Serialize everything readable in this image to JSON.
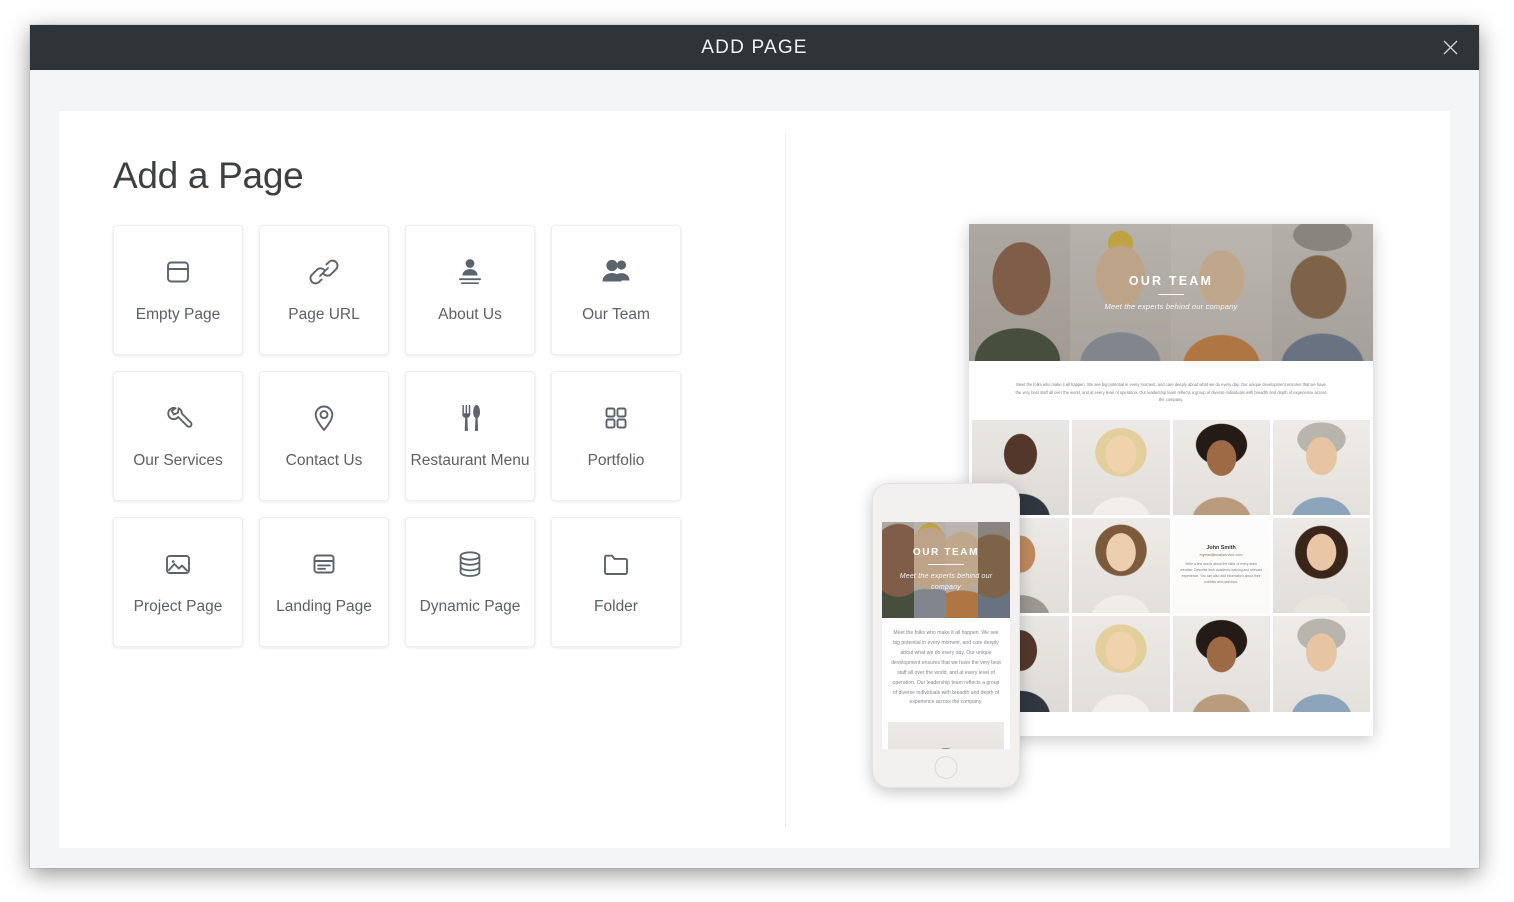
{
  "window": {
    "title": "ADD PAGE",
    "close_icon": "close-icon",
    "titlebar_color": "#2f3439"
  },
  "main": {
    "heading": "Add a Page",
    "page_types": [
      {
        "label": "Empty Page",
        "icon": "browser-window-icon"
      },
      {
        "label": "Page URL",
        "icon": "link-chain-icon"
      },
      {
        "label": "About Us",
        "icon": "person-lines-icon"
      },
      {
        "label": "Our Team",
        "icon": "two-people-icon"
      },
      {
        "label": "Our Services",
        "icon": "wrench-icon"
      },
      {
        "label": "Contact Us",
        "icon": "map-pin-icon"
      },
      {
        "label": "Restaurant Menu",
        "icon": "fork-knife-icon"
      },
      {
        "label": "Portfolio",
        "icon": "grid-squares-icon"
      },
      {
        "label": "Project Page",
        "icon": "image-icon"
      },
      {
        "label": "Landing Page",
        "icon": "card-lines-icon"
      },
      {
        "label": "Dynamic Page",
        "icon": "database-icon"
      },
      {
        "label": "Folder",
        "icon": "folder-icon"
      }
    ]
  },
  "preview": {
    "desktop": {
      "hero_title": "OUR TEAM",
      "hero_subtitle": "Meet the experts behind our company",
      "intro": "Meet the folks who make it all happen. We see big potential in every moment, and care deeply about what we do every day. Our unique development ensures that we have the very best staff all over the world, and at every level of operation. Our leadership team reflects a group of diverse individuals with breadth and depth of experience across the company.",
      "member_card": {
        "name": "John Smith",
        "email": "mymail@mailservice.com",
        "bio": "Write a few words about the skills of every team member. Describe their academic training and relevant experience. You can also add information about their hobbies and passions."
      }
    },
    "mobile": {
      "hero_title": "OUR TEAM",
      "hero_subtitle": "Meet the experts behind our company",
      "intro": "Meet the folks who make it all happen. We see big potential in every moment, and care deeply about what we do every day. Our unique development ensures that we have the very best staff all over the world, and at every level of operation. Our leadership team reflects a group of diverse individuals with breadth and depth of experience across the company."
    }
  }
}
